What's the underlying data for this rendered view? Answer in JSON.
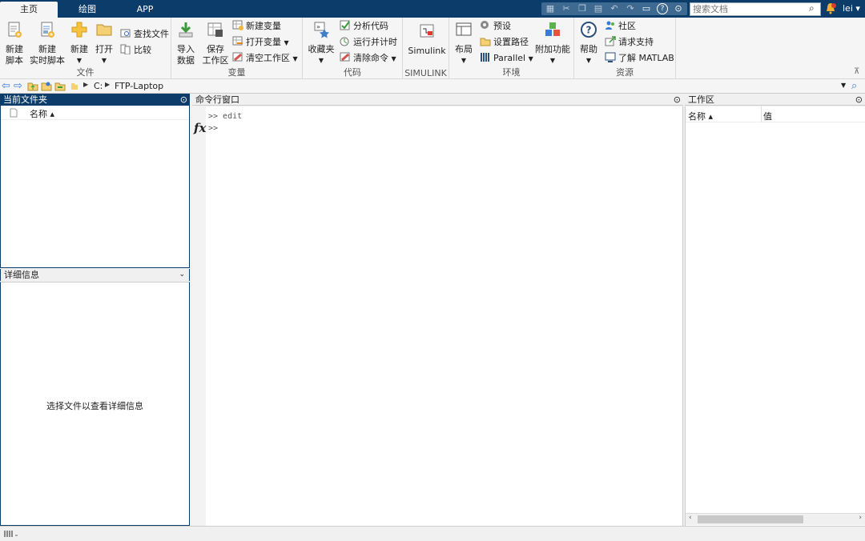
{
  "tabs": [
    {
      "label": "主页"
    },
    {
      "label": "绘图"
    },
    {
      "label": "APP"
    }
  ],
  "search": {
    "placeholder": "搜索文档"
  },
  "user": {
    "name": "lei ▾"
  },
  "ribbon": {
    "file": {
      "title": "文件",
      "new_script": "新建\n脚本",
      "new_live_script": "新建\n实时脚本",
      "new": "新建",
      "open": "打开",
      "find_files": "查找文件",
      "compare": "比较"
    },
    "variable": {
      "title": "变量",
      "import_data": "导入\n数据",
      "save_workspace": "保存\n工作区",
      "new_variable": "新建变量",
      "open_variable": "打开变量",
      "clear_workspace": "清空工作区"
    },
    "code": {
      "title": "代码",
      "favorites": "收藏夹",
      "analyze_code": "分析代码",
      "run_and_time": "运行并计时",
      "clear_commands": "清除命令"
    },
    "simulink": {
      "title": "SIMULINK",
      "simulink": "Simulink"
    },
    "environment": {
      "title": "环境",
      "layout": "布局",
      "preferences": "预设",
      "set_path": "设置路径",
      "parallel": "Parallel",
      "add_ons": "附加功能"
    },
    "resources": {
      "title": "资源",
      "help": "帮助",
      "community": "社区",
      "request_support": "请求支持",
      "learn_matlab": "了解 MATLAB"
    }
  },
  "address": {
    "drive": "C:",
    "folder": "FTP-Laptop"
  },
  "current_folder": {
    "title": "当前文件夹",
    "col_name": "名称 ▴"
  },
  "details": {
    "title": "详细信息",
    "message": "选择文件以查看详细信息"
  },
  "command_window": {
    "title": "命令行窗口",
    "lines": [
      ">> edit",
      ">>"
    ],
    "fx": "fx"
  },
  "workspace": {
    "title": "工作区",
    "col_name": "名称 ▴",
    "col_value": "值"
  },
  "colors": {
    "title_bar": "#0c3c6a",
    "panel_active_header": "#0c3c6a"
  }
}
